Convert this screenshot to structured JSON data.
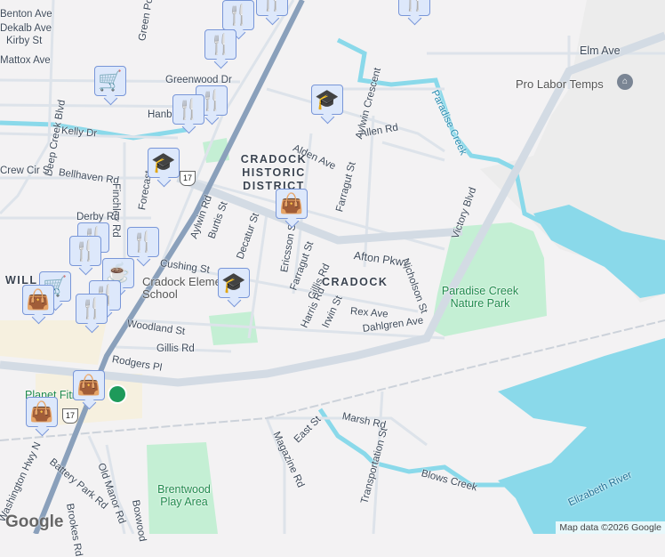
{
  "streets": [
    "Benton Ave",
    "Dekalb Ave",
    "Kirby St",
    "Mattox Ave",
    "Green Point",
    "Greenwood Dr",
    "Hanbury",
    "Kelly Dr",
    "Deep Creek Blvd",
    "Bellhaven Rd",
    "Finchley Rd",
    "Forecast",
    "Derby Rd",
    "Cushing St",
    "Aylwin Rd",
    "Burtis St",
    "Decatur St",
    "Ericsson St",
    "Farragut St",
    "Gillis Rd",
    "Harris Rd",
    "Irwin St",
    "Woodland St",
    "Gillis Rd",
    "Rodgers Pl",
    "Afton Pkwy",
    "Alden Ave",
    "Allen Rd",
    "Aylwin Crescent",
    "Farragut St",
    "Nicholson St",
    "Rex Ave",
    "Dahlgren Ave",
    "Victory Blvd",
    "Elm Ave",
    "Marsh Rd",
    "East St",
    "Magazine Rd",
    "Transportation St",
    "Blows Creek",
    "Battery Park Rd",
    "Old Manor Rd",
    "Boxwood",
    "Washington Hwy N",
    "Brookes Rd",
    "Paradise Creek",
    "Elizabeth River",
    "Crew Cir S"
  ],
  "districts": {
    "historic": "CRADOCK HISTORIC DISTRICT",
    "cradock": "CRADOCK",
    "william": "WILL"
  },
  "places": {
    "park1": "Paradise Creek Nature Park",
    "park2": "Brentwood Play Area",
    "school": "Cradock Elementary School",
    "gym": "Planet Fitness",
    "business": "Pro Labor Temps"
  },
  "route_shield": "17",
  "attribution": "Map data ©2026 Google",
  "logo": "Google",
  "icons": {
    "restaurant": "restaurant-icon",
    "school": "school-icon",
    "shopping": "shopping-bag-icon",
    "grocery": "shopping-cart-icon",
    "cafe": "coffee-icon"
  }
}
